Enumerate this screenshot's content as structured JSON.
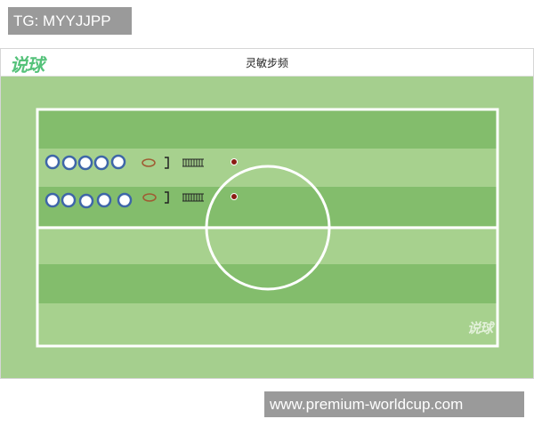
{
  "overlay": {
    "tg_label": "TG: MYYJJPP",
    "site_label": "www.premium-worldcup.com"
  },
  "header": {
    "logo_text": "说球",
    "title": "灵敏步频"
  },
  "field": {
    "colors": {
      "outer": "#a5cf8e",
      "stripe_dark": "#83bd6c",
      "stripe_light": "#a7d18e",
      "line": "#ffffff",
      "player_fill": "#ffffff",
      "player_ring": "#3e66a8",
      "ring_marker": "#a05a32",
      "cone": "#8a1c12",
      "ladder": "#222222"
    },
    "watermark_text": "说球",
    "rows": [
      {
        "players": 5,
        "ring": true,
        "hurdle": true,
        "ladder": true,
        "cone": true
      },
      {
        "players": 5,
        "ring": true,
        "hurdle": true,
        "ladder": true,
        "cone": true
      }
    ]
  }
}
